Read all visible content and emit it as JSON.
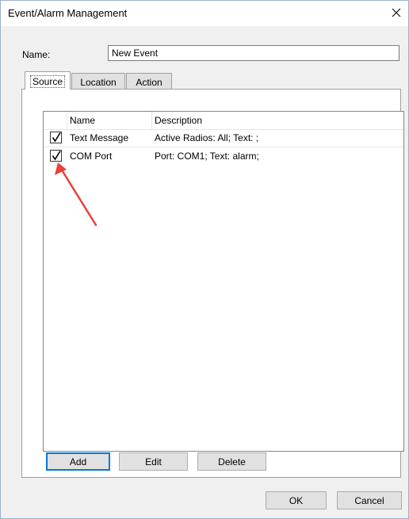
{
  "window": {
    "title": "Event/Alarm Management",
    "close_icon": "close-icon"
  },
  "form": {
    "name_label": "Name:",
    "name_value": "New Event"
  },
  "tabs": [
    {
      "label": "Source",
      "active": true
    },
    {
      "label": "Location",
      "active": false
    },
    {
      "label": "Action",
      "active": false
    }
  ],
  "source_list": {
    "columns": [
      "",
      "Name",
      "Description"
    ],
    "rows": [
      {
        "checked": true,
        "name": "Text Message",
        "description": "Active Radios: All; Text: ;"
      },
      {
        "checked": true,
        "name": "COM Port",
        "description": "Port: COM1; Text: alarm;"
      }
    ]
  },
  "list_buttons": {
    "add": "Add",
    "edit": "Edit",
    "delete": "Delete"
  },
  "dialog_buttons": {
    "ok": "OK",
    "cancel": "Cancel"
  },
  "colors": {
    "annotation_arrow": "#e8413c",
    "default_button_border": "#0078d7"
  }
}
